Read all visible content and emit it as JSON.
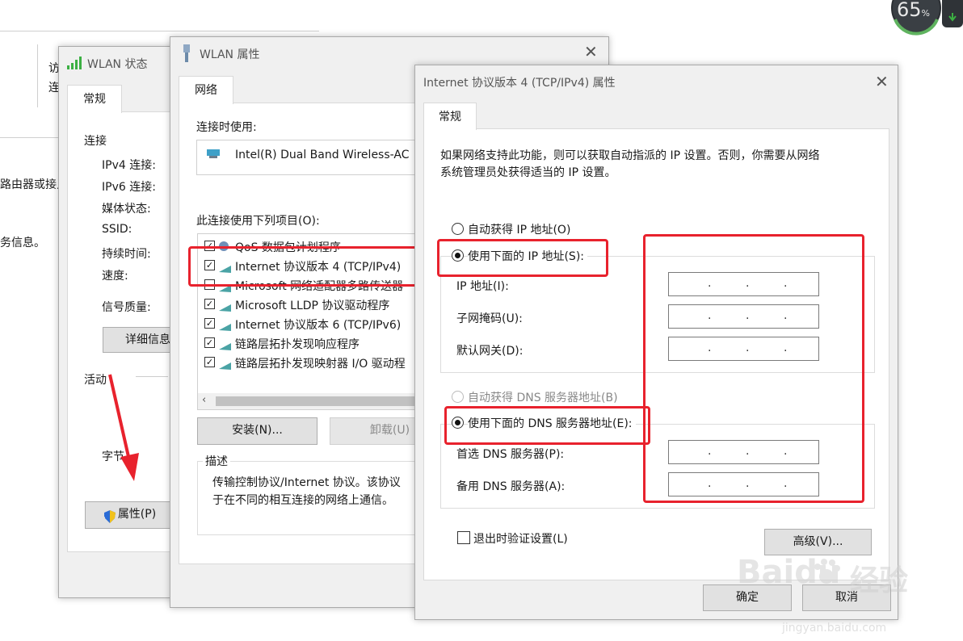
{
  "bg_left": {
    "line1": "访",
    "line2": "连",
    "line3": "路由器或接入",
    "line4": "务信息。"
  },
  "wlan_status": {
    "title": "WLAN 状态",
    "tab": "常规",
    "section_connection": "连接",
    "rows": [
      "IPv4 连接:",
      "IPv6 连接:",
      "媒体状态:",
      "SSID:",
      "持续时间:",
      "速度:"
    ],
    "signal": "信号质量:",
    "details_button": "详细信息",
    "section_activity": "活动",
    "bytes_label": "字节",
    "properties_button": "属性(P)"
  },
  "wlan_props": {
    "title": "WLAN 属性",
    "tab": "网络",
    "connect_using": "连接时使用:",
    "adapter": "Intel(R) Dual Band Wireless-AC",
    "items_label": "此连接使用下列项目(O):",
    "items": [
      {
        "label": "QoS 数据包计划程序",
        "checked": true
      },
      {
        "label": "Internet 协议版本 4 (TCP/IPv4)",
        "checked": true
      },
      {
        "label": "Microsoft 网络适配器多路传送器",
        "checked": false
      },
      {
        "label": "Microsoft LLDP 协议驱动程序",
        "checked": true
      },
      {
        "label": "Internet 协议版本 6 (TCP/IPv6)",
        "checked": true
      },
      {
        "label": "链路层拓扑发现响应程序",
        "checked": true
      },
      {
        "label": "链路层拓扑发现映射器 I/O 驱动程",
        "checked": true
      }
    ],
    "install_button": "安装(N)...",
    "uninstall_button": "卸载(U)",
    "description_label": "描述",
    "description_line1": "传输控制协议/Internet 协议。该协议",
    "description_line2": "于在不同的相互连接的网络上通信。"
  },
  "ipv4_props": {
    "title": "Internet 协议版本 4 (TCP/IPv4) 属性",
    "tab": "常规",
    "intro_line1": "如果网络支持此功能，则可以获取自动指派的 IP 设置。否则，你需要从网络",
    "intro_line2": "系统管理员处获得适当的 IP 设置。",
    "auto_ip": "自动获得 IP 地址(O)",
    "manual_ip": "使用下面的 IP 地址(S):",
    "ip_address": "IP 地址(I):",
    "subnet": "子网掩码(U):",
    "gateway": "默认网关(D):",
    "auto_dns": "自动获得 DNS 服务器地址(B)",
    "manual_dns": "使用下面的 DNS 服务器地址(E):",
    "preferred_dns": "首选 DNS 服务器(P):",
    "alternate_dns": "备用 DNS 服务器(A):",
    "validate": "退出时验证设置(L)",
    "advanced_button": "高级(V)...",
    "ok_button": "确定",
    "cancel_button": "取消",
    "ip_dot": "."
  },
  "widget": {
    "percent": "65",
    "unit": "%"
  },
  "watermark": {
    "brand": "Baidu",
    "cn": "经验",
    "url": "jingyan.baidu.com"
  },
  "colors": {
    "accent_red": "#e8222d",
    "green": "#3cb043"
  }
}
